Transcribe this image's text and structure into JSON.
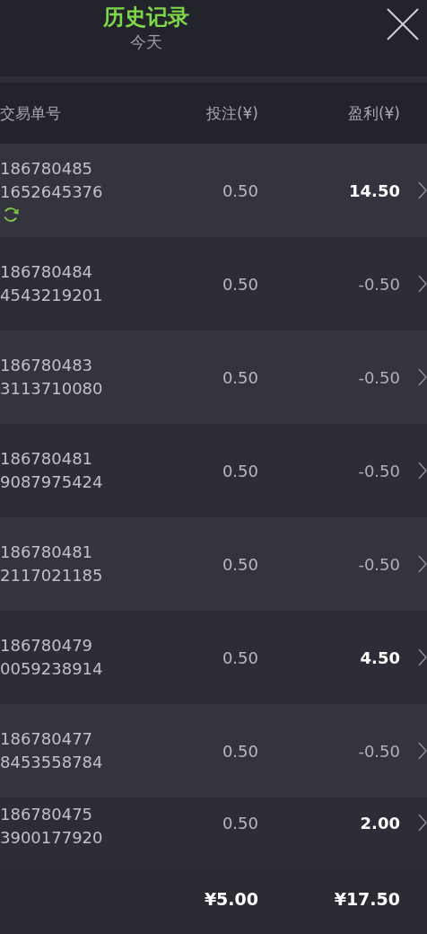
{
  "header": {
    "title": "历史记录",
    "subtitle": "今天"
  },
  "table": {
    "columns": [
      "交易单号",
      "投注(¥)",
      "盈利(¥)"
    ],
    "rows": [
      {
        "order": [
          "186780485",
          "1652645376"
        ],
        "stake": "0.50",
        "profit": "14.50",
        "won": true,
        "pending": true
      },
      {
        "order": [
          "186780484",
          "4543219201"
        ],
        "stake": "0.50",
        "profit": "-0.50",
        "won": false,
        "pending": false
      },
      {
        "order": [
          "186780483",
          "3113710080"
        ],
        "stake": "0.50",
        "profit": "-0.50",
        "won": false,
        "pending": false
      },
      {
        "order": [
          "186780481",
          "9087975424"
        ],
        "stake": "0.50",
        "profit": "-0.50",
        "won": false,
        "pending": false
      },
      {
        "order": [
          "186780481",
          "2117021185"
        ],
        "stake": "0.50",
        "profit": "-0.50",
        "won": false,
        "pending": false
      },
      {
        "order": [
          "186780479",
          "0059238914"
        ],
        "stake": "0.50",
        "profit": "4.50",
        "won": true,
        "pending": false
      },
      {
        "order": [
          "186780477",
          "8453558784"
        ],
        "stake": "0.50",
        "profit": "-0.50",
        "won": false,
        "pending": false
      },
      {
        "order": [
          "186780475",
          "3900177920"
        ],
        "stake": "0.50",
        "profit": "2.00",
        "won": true,
        "pending": false
      }
    ]
  },
  "totals": {
    "stake": "¥5.00",
    "profit": "¥17.50"
  }
}
